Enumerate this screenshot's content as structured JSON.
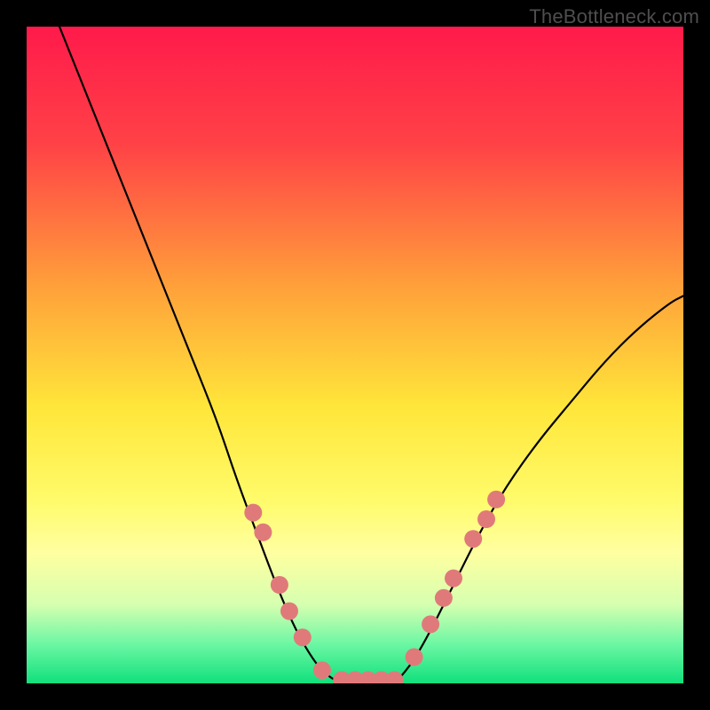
{
  "watermark": "TheBottleneck.com",
  "chart_data": {
    "type": "line",
    "title": "",
    "xlabel": "",
    "ylabel": "",
    "xlim": [
      0,
      100
    ],
    "ylim": [
      0,
      100
    ],
    "background_gradient_stops": [
      {
        "offset": 0,
        "color": "#ff1a4b"
      },
      {
        "offset": 18,
        "color": "#ff4246"
      },
      {
        "offset": 40,
        "color": "#ffa23a"
      },
      {
        "offset": 58,
        "color": "#ffe63a"
      },
      {
        "offset": 72,
        "color": "#fffb6a"
      },
      {
        "offset": 80,
        "color": "#ffffa0"
      },
      {
        "offset": 88,
        "color": "#d6ffb0"
      },
      {
        "offset": 94,
        "color": "#6cf7a4"
      },
      {
        "offset": 100,
        "color": "#11e07c"
      }
    ],
    "series": [
      {
        "name": "left-curve",
        "color": "#000000",
        "points": [
          {
            "x": 5,
            "y": 100
          },
          {
            "x": 9,
            "y": 90
          },
          {
            "x": 13,
            "y": 80
          },
          {
            "x": 17,
            "y": 70
          },
          {
            "x": 21,
            "y": 60
          },
          {
            "x": 25,
            "y": 50
          },
          {
            "x": 29,
            "y": 40
          },
          {
            "x": 32,
            "y": 31
          },
          {
            "x": 35,
            "y": 23
          },
          {
            "x": 38,
            "y": 15
          },
          {
            "x": 41,
            "y": 8
          },
          {
            "x": 44,
            "y": 3
          },
          {
            "x": 46,
            "y": 1
          },
          {
            "x": 48,
            "y": 0
          }
        ]
      },
      {
        "name": "bottom-flat",
        "color": "#000000",
        "points": [
          {
            "x": 48,
            "y": 0
          },
          {
            "x": 52,
            "y": 0
          },
          {
            "x": 56,
            "y": 0
          }
        ]
      },
      {
        "name": "right-curve",
        "color": "#000000",
        "points": [
          {
            "x": 56,
            "y": 0
          },
          {
            "x": 58,
            "y": 2
          },
          {
            "x": 61,
            "y": 7
          },
          {
            "x": 65,
            "y": 15
          },
          {
            "x": 69,
            "y": 23
          },
          {
            "x": 73,
            "y": 30
          },
          {
            "x": 78,
            "y": 37
          },
          {
            "x": 83,
            "y": 43
          },
          {
            "x": 88,
            "y": 49
          },
          {
            "x": 93,
            "y": 54
          },
          {
            "x": 98,
            "y": 58
          },
          {
            "x": 100,
            "y": 59
          }
        ]
      }
    ],
    "markers": {
      "name": "highlight-dots",
      "color": "#e07a7a",
      "radius": 10,
      "points": [
        {
          "x": 34.5,
          "y": 26
        },
        {
          "x": 36.0,
          "y": 23
        },
        {
          "x": 38.5,
          "y": 15
        },
        {
          "x": 40.0,
          "y": 11
        },
        {
          "x": 42.0,
          "y": 7
        },
        {
          "x": 45.0,
          "y": 2
        },
        {
          "x": 48.0,
          "y": 0.5
        },
        {
          "x": 50.0,
          "y": 0.5
        },
        {
          "x": 52.0,
          "y": 0.5
        },
        {
          "x": 54.0,
          "y": 0.5
        },
        {
          "x": 56.0,
          "y": 0.5
        },
        {
          "x": 59.0,
          "y": 4
        },
        {
          "x": 61.5,
          "y": 9
        },
        {
          "x": 63.5,
          "y": 13
        },
        {
          "x": 65.0,
          "y": 16
        },
        {
          "x": 68.0,
          "y": 22
        },
        {
          "x": 70.0,
          "y": 25
        },
        {
          "x": 71.5,
          "y": 28
        }
      ]
    }
  }
}
